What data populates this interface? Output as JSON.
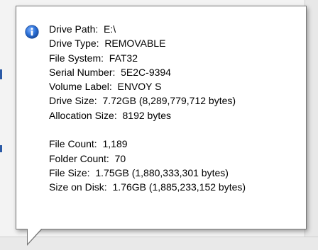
{
  "tooltip": {
    "icon": "info-icon",
    "group1": [
      "Drive Path:  E:\\",
      "Drive Type:  REMOVABLE",
      "File System:  FAT32",
      "Serial Number:  5E2C-9394",
      "Volume Label:  ENVOY S",
      "Drive Size:  7.72GB (8,289,779,712 bytes)",
      "Allocation Size:  8192 bytes"
    ],
    "group2": [
      "File Count:  1,189",
      "Folder Count:  70",
      "File Size:  1.75GB (1,880,333,301 bytes)",
      "Size on Disk:  1.76GB (1,885,233,152 bytes)"
    ]
  },
  "colors": {
    "tooltip_border": "#767676",
    "icon_blue": "#2a6fd6"
  }
}
